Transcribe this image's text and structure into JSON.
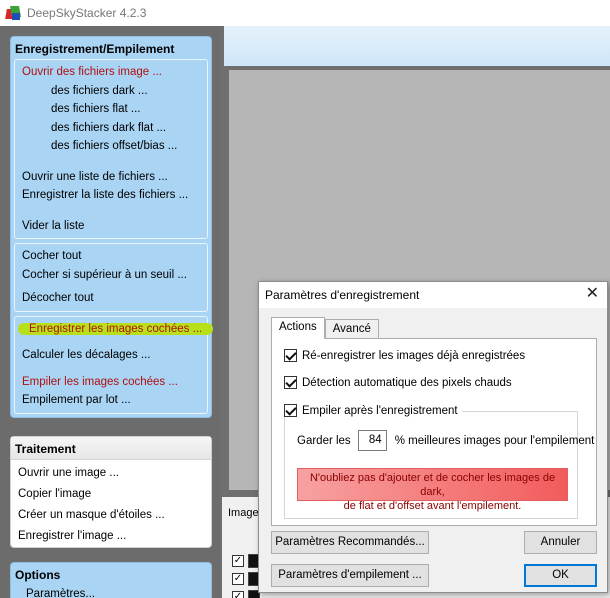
{
  "window": {
    "title": "DeepSkyStacker 4.2.3"
  },
  "registration_panel": {
    "title": "Enregistrement/Empilement",
    "open_group": {
      "open_images": "Ouvrir des fichiers image ...",
      "dark": "des fichiers dark ...",
      "flat": "des fichiers flat ...",
      "dark_flat": "des fichiers dark flat ...",
      "offset": "des fichiers offset/bias ...",
      "open_list": "Ouvrir une liste de fichiers ...",
      "save_list": "Enregistrer la liste des fichiers ...",
      "clear_list": "Vider la liste"
    },
    "check_group": {
      "check_all": "Cocher tout",
      "check_threshold": "Cocher si supérieur à un seuil ...",
      "uncheck_all": "Décocher tout"
    },
    "stack_group": {
      "register_checked": "Enregistrer les images cochées ...",
      "compute_offsets": "Calculer les décalages ...",
      "stack_checked": "Empiler les images cochées ...",
      "batch_stacking": "Empilement par lot ..."
    }
  },
  "processing_panel": {
    "title": "Traitement",
    "open_image": "Ouvrir une image ...",
    "copy_image": "Copier l'image",
    "star_mask": "Créer un masque d'étoiles ...",
    "save_image": "Enregistrer l'image ..."
  },
  "options_panel": {
    "title": "Options",
    "settings": "Paramètres..."
  },
  "image_list": {
    "label": "Image"
  },
  "dialog": {
    "title": "Paramètres d'enregistrement",
    "close": "✕",
    "tabs": [
      "Actions",
      "Avancé"
    ],
    "reregister": "Ré-enregistrer les images déjà enregistrées",
    "hot_pixels": "Détection automatique des pixels chauds",
    "stack_after": "Empiler après l'enregistrement",
    "keep_prefix": "Garder les",
    "keep_value": "84",
    "keep_suffix": "% meilleures images pour l'empilement",
    "warning_line1": "N'oubliez pas d'ajouter et de cocher les images de dark,",
    "warning_line2": "de flat et d'offset avant l'empilement.",
    "recommended_button": "Paramètres Recommandés...",
    "cancel_button": "Annuler",
    "stacking_params_button": "Paramètres d'empilement ...",
    "ok_button": "OK"
  },
  "colors": {
    "panel_blue": "#a9d4f4",
    "link_red": "#b01010",
    "highlight": "#b8e01a",
    "warning_red": "#f25c5c",
    "accent": "#0078d7"
  }
}
